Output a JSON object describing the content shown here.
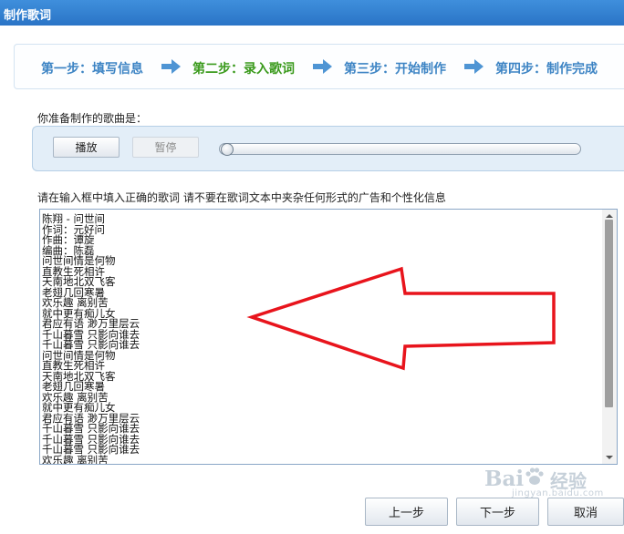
{
  "window": {
    "title": "制作歌词"
  },
  "steps": {
    "items": [
      {
        "label": "第一步：填写信息",
        "active": false
      },
      {
        "label": "第二步：录入歌词",
        "active": true
      },
      {
        "label": "第三步：开始制作",
        "active": false
      },
      {
        "label": "第四步：制作完成",
        "active": false
      }
    ]
  },
  "song": {
    "prompt_label": "你准备制作的歌曲是："
  },
  "player": {
    "play_label": "播放",
    "pause_label": "暂停",
    "progress_fraction": 0.0
  },
  "instruction": "请在输入框中填入正确的歌词 请不要在歌词文本中夹杂任何形式的广告和个性化信息",
  "lyrics": {
    "lines": [
      "陈翔 - 问世间",
      "作词：元好问",
      "作曲：谭旋",
      "编曲：陈磊",
      "问世间情是何物",
      "直教生死相许",
      "天南地北双飞客",
      "老翅几回寒暑",
      "欢乐趣 离别苦",
      "就中更有痴儿女",
      "君应有语 渺万里层云",
      "千山暮雪 只影向谁去",
      "千山暮雪 只影向谁去",
      "问世间情是何物",
      "直教生死相许",
      "天南地北双飞客",
      "老翅几回寒暑",
      "欢乐趣 离别苦",
      "就中更有痴儿女",
      "君应有语 渺万里层云",
      "千山暮雪 只影向谁去",
      "千山暮雪 只影向谁去",
      "千山暮雪 只影向谁去",
      "欢乐趣 离别苦"
    ]
  },
  "buttons": {
    "prev_label": "上一步",
    "next_label": "下一步",
    "cancel_label": "取消"
  },
  "annotation": {
    "color": "#e8141c"
  },
  "watermark": {
    "brand": "Bai",
    "text": "经验",
    "url": "jingyan.baidu.com"
  }
}
